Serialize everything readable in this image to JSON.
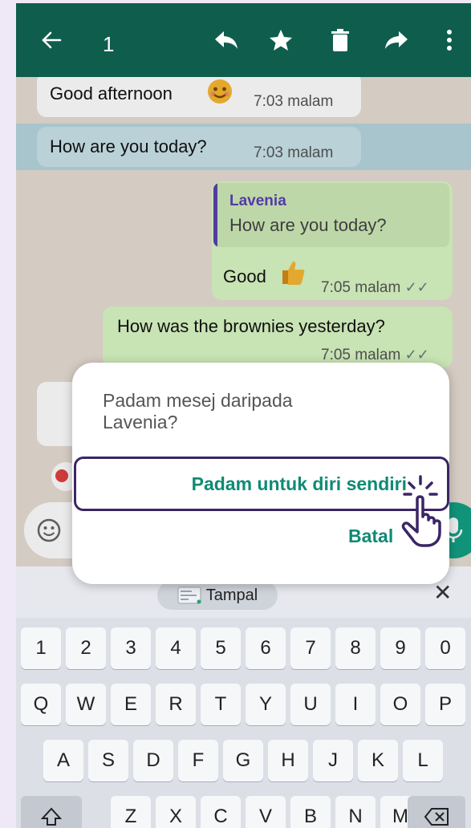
{
  "topbar": {
    "selected_count": "1",
    "icons": [
      "back-arrow-icon",
      "reply-icon",
      "star-icon",
      "trash-icon",
      "forward-icon",
      "more-vert-icon"
    ]
  },
  "messages": [
    {
      "direction": "in",
      "text": "Good afternoon",
      "emoji": "smile-emoji-icon",
      "time": "7:03 malam"
    },
    {
      "direction": "in",
      "text": "How are you today?",
      "time": "7:03 malam",
      "selected": true
    },
    {
      "direction": "out",
      "quote_author": "Lavenia",
      "quote_text": "How are you today?",
      "text": "Good",
      "emoji": "thumbs-up-emoji-icon",
      "time": "7:05 malam"
    },
    {
      "direction": "out",
      "text": "How was the brownies yesterday?",
      "time": "7:05 malam"
    }
  ],
  "dialog": {
    "title": "Padam mesej daripada Lavenia?",
    "delete_for_me": "Padam untuk diri sendiri",
    "cancel": "Batal"
  },
  "keyboard": {
    "paste_label": "Tampal",
    "number_row": [
      "1",
      "2",
      "3",
      "4",
      "5",
      "6",
      "7",
      "8",
      "9",
      "0"
    ],
    "row1": [
      "Q",
      "W",
      "E",
      "R",
      "T",
      "Y",
      "U",
      "I",
      "O",
      "P"
    ],
    "row2": [
      "A",
      "S",
      "D",
      "F",
      "G",
      "H",
      "J",
      "K",
      "L"
    ],
    "row3": [
      "Z",
      "X",
      "C",
      "V",
      "B",
      "N",
      "M"
    ]
  },
  "colors": {
    "topbar": "#0f5d4d",
    "accent": "#0f8a74",
    "outgoing_bubble": "#d9f7c4",
    "selected_row": "#b7d5df",
    "highlight_border": "#3b2566"
  }
}
